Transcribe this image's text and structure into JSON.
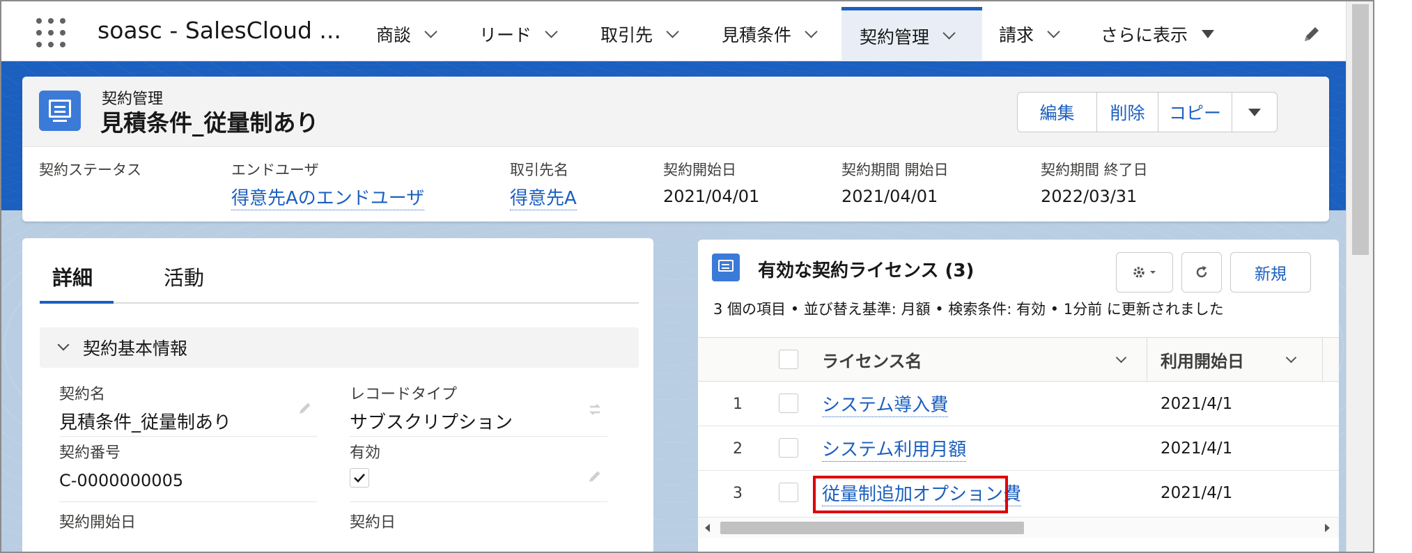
{
  "nav": {
    "app_name": "soasc - SalesCloud ...",
    "items": [
      {
        "label": "商談"
      },
      {
        "label": "リード"
      },
      {
        "label": "取引先"
      },
      {
        "label": "見積条件"
      },
      {
        "label": "契約管理"
      },
      {
        "label": "請求"
      },
      {
        "label": "さらに表示"
      }
    ],
    "active_item": "契約管理"
  },
  "record": {
    "object_type": "契約管理",
    "title": "見積条件_従量制あり",
    "actions": {
      "edit": "編集",
      "delete": "削除",
      "copy": "コピー"
    },
    "highlights": [
      {
        "label": "契約ステータス",
        "value": ""
      },
      {
        "label": "エンドユーザ",
        "value": "得意先Aのエンドユーザ"
      },
      {
        "label": "取引先名",
        "value": "得意先A"
      },
      {
        "label": "契約開始日",
        "value": "2021/04/01"
      },
      {
        "label": "契約期間 開始日",
        "value": "2021/04/01"
      },
      {
        "label": "契約期間 終了日",
        "value": "2022/03/31"
      }
    ]
  },
  "detail": {
    "tabs": [
      {
        "label": "詳細"
      },
      {
        "label": "活動"
      }
    ],
    "active_tab": "詳細",
    "section_title": "契約基本情報",
    "fields": {
      "contract_name": {
        "label": "契約名",
        "value": "見積条件_従量制あり"
      },
      "record_type": {
        "label": "レコードタイプ",
        "value": "サブスクリプション"
      },
      "contract_number": {
        "label": "契約番号",
        "value": "C-0000000005"
      },
      "active": {
        "label": "有効",
        "checked": true
      },
      "contract_start": {
        "label": "契約開始日"
      },
      "contract_date": {
        "label": "契約日"
      }
    }
  },
  "related_list": {
    "title": "有効な契約ライセンス (3)",
    "subtitle": "3 個の項目 • 並び替え基準: 月額 • 検索条件: 有効 • 1分前 に更新されました",
    "new_button": "新規",
    "columns": {
      "name": "ライセンス名",
      "start": "利用開始日"
    },
    "rows": [
      {
        "num": "1",
        "name": "システム導入費",
        "start": "2021/4/1"
      },
      {
        "num": "2",
        "name": "システム利用月額",
        "start": "2021/4/1"
      },
      {
        "num": "3",
        "name": "従量制追加オプション費",
        "start": "2021/4/1"
      }
    ],
    "highlighted_row": 3
  },
  "colors": {
    "brand": "#1b5fbf",
    "icon": "#3c7ad8",
    "highlight_box": "#e00000"
  },
  "icons": [
    "app-launcher-icon",
    "chevron-down-icon",
    "pencil-icon",
    "record-icon",
    "gear-icon",
    "refresh-icon",
    "checkmark-icon"
  ]
}
